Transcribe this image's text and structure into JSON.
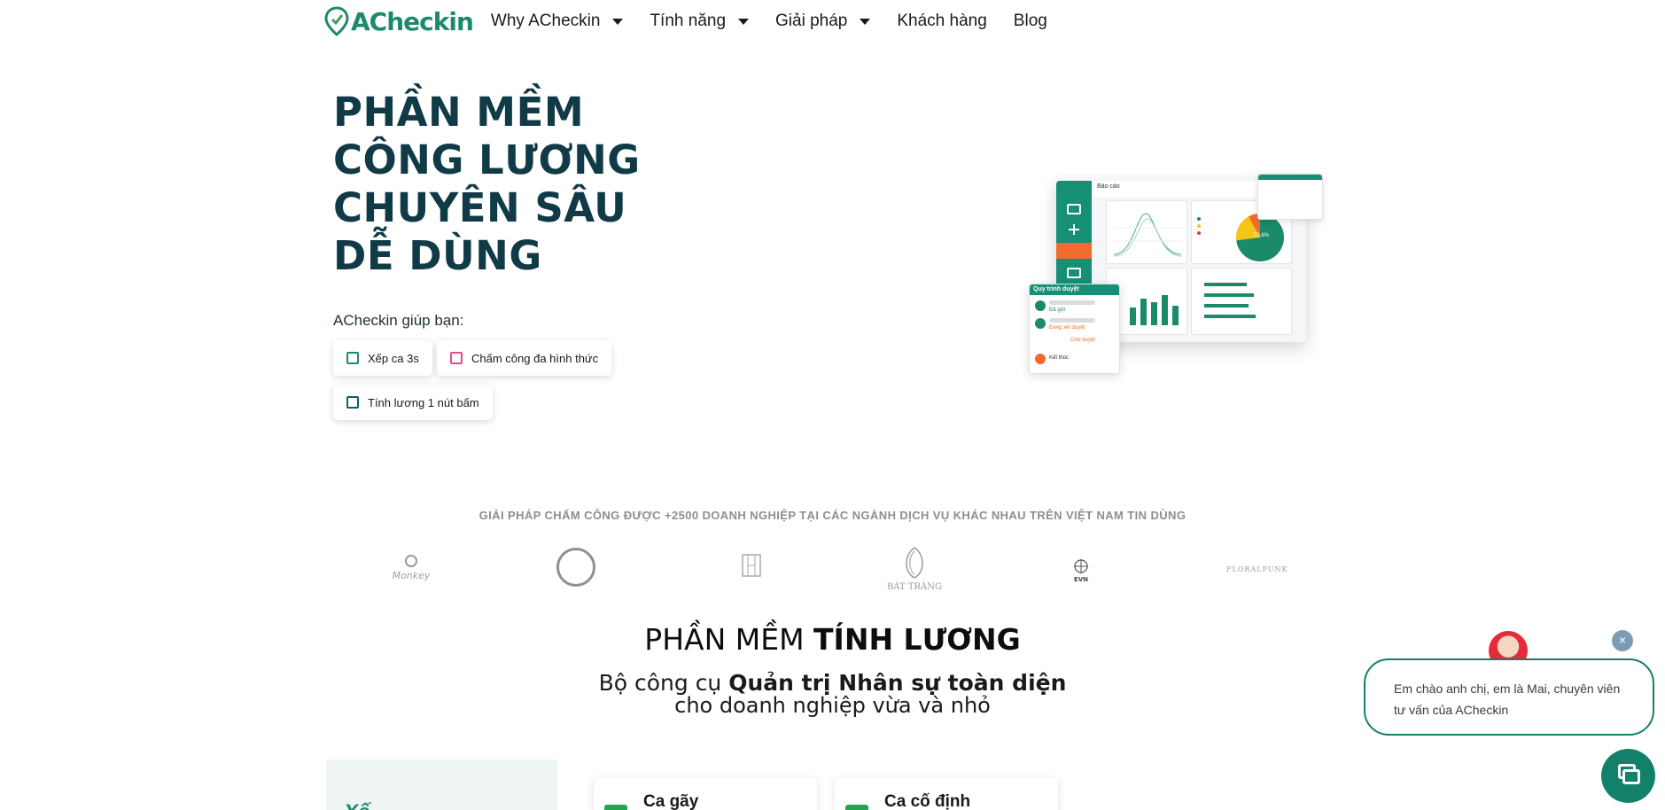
{
  "nav": {
    "logo_text": "ACheckin",
    "items": [
      {
        "label": "Why ACheckin",
        "dropdown": true
      },
      {
        "label": "Tính năng",
        "dropdown": true
      },
      {
        "label": "Giải pháp",
        "dropdown": true
      },
      {
        "label": "Khách hàng",
        "dropdown": false
      },
      {
        "label": "Blog",
        "dropdown": false
      }
    ]
  },
  "hero": {
    "title_lines": [
      "PHẦN MỀM",
      "CÔNG LƯƠNG",
      "CHUYÊN SÂU",
      "DỄ DÙNG"
    ],
    "subtitle": "ACheckin giúp bạn:",
    "chips": [
      "Xếp ca 3s",
      "Chấm công đa hình thức",
      "Tính lương 1 nút bấm"
    ]
  },
  "mockup": {
    "header": "Báo cáo",
    "pie_label": "73,6%",
    "approval_title": "Quy trình duyệt",
    "approval_steps": [
      "Đã gửi",
      "Đang xét duyệt",
      "Chờ duyệt",
      "Kết thúc"
    ]
  },
  "trust": {
    "title": "GIẢI PHÁP CHẤM CÔNG ĐƯỢC +2500 DOANH NGHIỆP TẠI CÁC NGÀNH DỊCH VỤ KHÁC NHAU TRÊN VIỆT NAM TIN DÙNG",
    "brands": [
      "Monkey",
      "BÁT TRÀNG",
      "EVN",
      "FLORALPUNK"
    ]
  },
  "section": {
    "title_normal": "PHẦN MỀM ",
    "title_bold": "TÍNH LƯƠNG",
    "sub1_normal": "Bộ công cụ ",
    "sub1_bold": "Quản trị Nhân sự toàn diện",
    "sub2": "cho doanh nghiệp vừa và nhỏ",
    "left_panel_text": "Xế",
    "cards": [
      "Ca gãy",
      "Ca cố định"
    ]
  },
  "chat": {
    "close": "×",
    "message": "Em chào anh chị, em là Mai, chuyên viên tư vấn của ACheckin"
  },
  "colors": {
    "brand_green": "#1e8a6d",
    "title_dark": "#0f3a46",
    "accent_orange": "#f26b2d",
    "chat_green": "#13806a"
  }
}
